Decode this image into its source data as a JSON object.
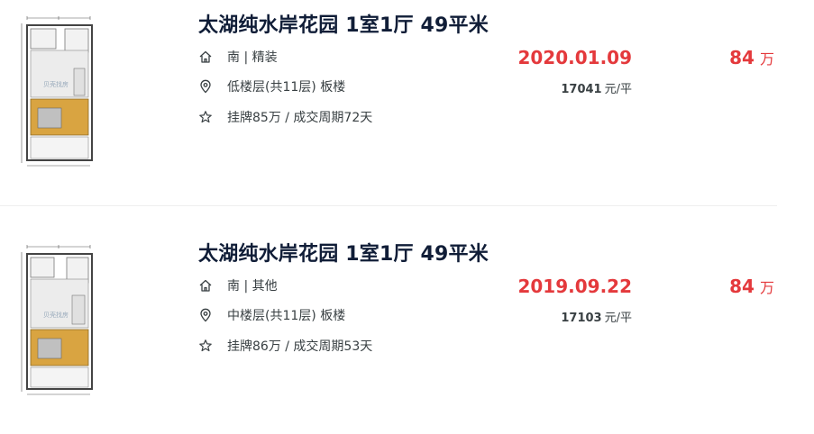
{
  "listings": [
    {
      "title": "太湖纯水岸花园 1室1厅 49平米",
      "house_info": "南 | 精装",
      "position_info": "低楼层(共11层) 板楼",
      "deal_cycle": "挂牌85万 / 成交周期72天",
      "deal_date": "2020.01.09",
      "unit_price_value": "17041",
      "unit_price_unit": "元/平",
      "total_price_value": "84",
      "total_price_unit": "万",
      "floorplan_watermark": "贝壳找房"
    },
    {
      "title": "太湖纯水岸花园 1室1厅 49平米",
      "house_info": "南 | 其他",
      "position_info": "中楼层(共11层) 板楼",
      "deal_cycle": "挂牌86万 / 成交周期53天",
      "deal_date": "2019.09.22",
      "unit_price_value": "17103",
      "unit_price_unit": "元/平",
      "total_price_value": "84",
      "total_price_unit": "万",
      "floorplan_watermark": "贝壳找房"
    }
  ],
  "colors": {
    "title": "#101d37",
    "price_red": "#e4393c",
    "text": "#394043",
    "floor_wood": "#d9a441"
  },
  "icons": {
    "house_info": "house-outline-icon",
    "position_info": "location-pin-icon",
    "deal_cycle": "star-outline-icon"
  }
}
